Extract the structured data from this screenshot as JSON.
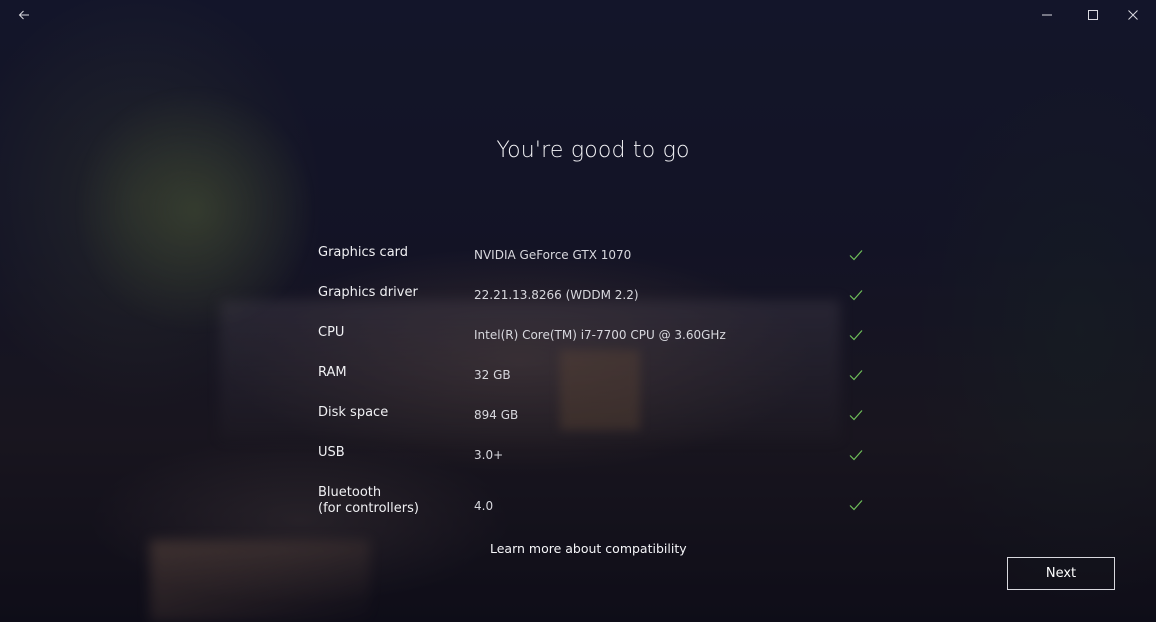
{
  "titlebar": {
    "back_icon": "back-arrow-icon",
    "minimize_icon": "minimize-icon",
    "maximize_icon": "maximize-icon",
    "close_icon": "close-icon"
  },
  "heading": "You're good to go",
  "specs": [
    {
      "label": "Graphics card",
      "value": "NVIDIA GeForce GTX 1070",
      "status_icon": "check-icon"
    },
    {
      "label": "Graphics driver",
      "value": "22.21.13.8266 (WDDM 2.2)",
      "status_icon": "check-icon"
    },
    {
      "label": "CPU",
      "value": "Intel(R) Core(TM) i7-7700 CPU @ 3.60GHz",
      "status_icon": "check-icon"
    },
    {
      "label": "RAM",
      "value": "32 GB",
      "status_icon": "check-icon"
    },
    {
      "label": "Disk space",
      "value": "894 GB",
      "status_icon": "check-icon"
    },
    {
      "label": "USB",
      "value": "3.0+",
      "status_icon": "check-icon"
    },
    {
      "label": "Bluetooth",
      "label_sub": "(for controllers)",
      "value": "4.0",
      "status_icon": "check-icon"
    }
  ],
  "learn_more": "Learn more about compatibility",
  "next_label": "Next",
  "colors": {
    "check": "#6fbf5a",
    "text": "#ffffff",
    "button_border": "#d8d8de"
  }
}
